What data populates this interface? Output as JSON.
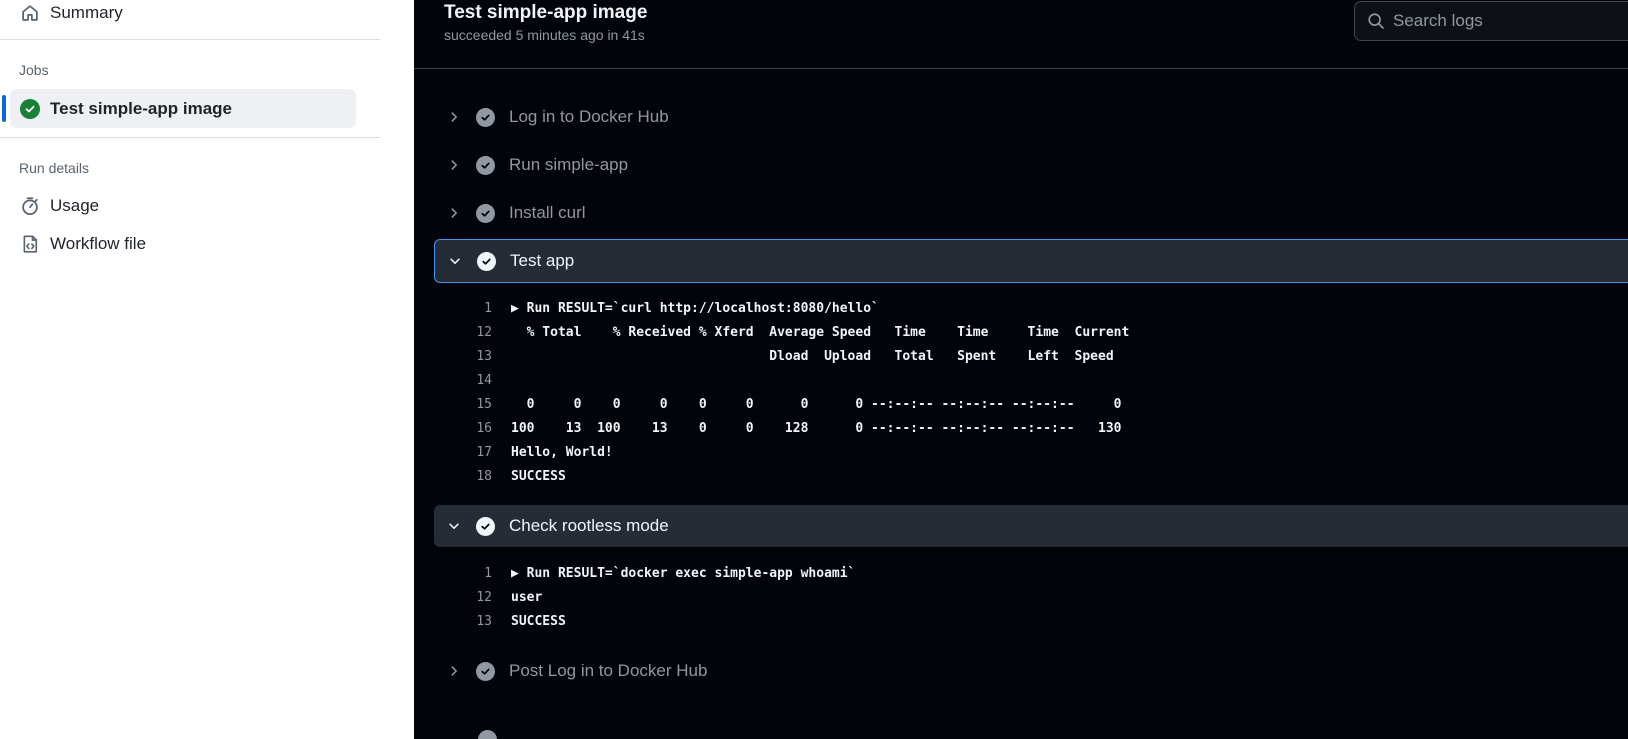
{
  "sidebar": {
    "summary_label": "Summary",
    "jobs_heading": "Jobs",
    "job_label": "Test simple-app image",
    "run_details_heading": "Run details",
    "usage_label": "Usage",
    "workflow_file_label": "Workflow file"
  },
  "header": {
    "title": "Test simple-app image",
    "subtitle": "succeeded 5 minutes ago in 41s",
    "search_placeholder": "Search logs"
  },
  "steps": [
    {
      "name": "Log in to Docker Hub",
      "state": "collapsed"
    },
    {
      "name": "Run simple-app",
      "state": "collapsed"
    },
    {
      "name": "Install curl",
      "state": "collapsed"
    },
    {
      "name": "Test app",
      "state": "expanded"
    },
    {
      "name": "Check rootless mode",
      "state": "expanded"
    },
    {
      "name": "Post Log in to Docker Hub",
      "state": "collapsed"
    }
  ],
  "test_app_log": [
    {
      "n": "1",
      "t": "▶ Run RESULT=`curl http://localhost:8080/hello`"
    },
    {
      "n": "12",
      "t": "  % Total    % Received % Xferd  Average Speed   Time    Time     Time  Current"
    },
    {
      "n": "13",
      "t": "                                 Dload  Upload   Total   Spent    Left  Speed"
    },
    {
      "n": "14",
      "t": ""
    },
    {
      "n": "15",
      "t": "  0     0    0     0    0     0      0      0 --:--:-- --:--:-- --:--:--     0"
    },
    {
      "n": "16",
      "t": "100    13  100    13    0     0    128      0 --:--:-- --:--:-- --:--:--   130"
    },
    {
      "n": "17",
      "t": "Hello, World!"
    },
    {
      "n": "18",
      "t": "SUCCESS"
    }
  ],
  "rootless_log": [
    {
      "n": "1",
      "t": "▶ Run RESULT=`docker exec simple-app whoami`"
    },
    {
      "n": "12",
      "t": "user"
    },
    {
      "n": "13",
      "t": "SUCCESS"
    }
  ],
  "colors": {
    "success": "#1a7f37",
    "accent": "#0969da",
    "log_bg": "#010409",
    "focus": "#4493f8"
  }
}
